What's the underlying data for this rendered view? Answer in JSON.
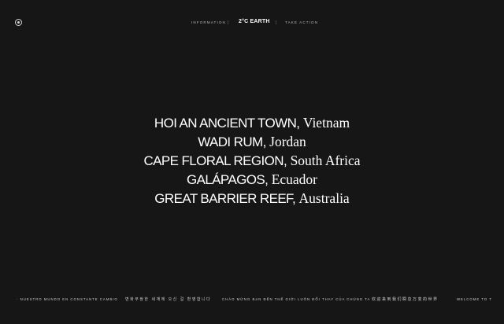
{
  "nav": {
    "information": "INFORMATION",
    "logo": "2°C EARTH",
    "take_action": "TAKE ACTION",
    "separator": "|"
  },
  "sites": [
    {
      "name": "HOI AN ANCIENT TOWN,",
      "country": "Vietnam"
    },
    {
      "name": "WADI RUM,",
      "country": "Jordan"
    },
    {
      "name": "CAPE FLORAL REGION,",
      "country": "South Africa"
    },
    {
      "name": "GALÁPAGOS,",
      "country": "Ecuador"
    },
    {
      "name": "GREAT BARRIER REEF,",
      "country": "Australia"
    }
  ],
  "ticker": [
    "· NUESTRO MUNDO EN CONSTANTE CAMBIO",
    "변화무쌍한 세계에 오신 걸 환영합니다",
    "CHÀO MỪNG BẠN ĐẾN THẾ GIỚI LUÔN ĐỔI THAY CỦA CHÚNG TA",
    "欢迎来到我们瞬息万变的世界",
    "WELCOME TO T"
  ],
  "icons": {
    "sound": "circle-dot-icon"
  }
}
